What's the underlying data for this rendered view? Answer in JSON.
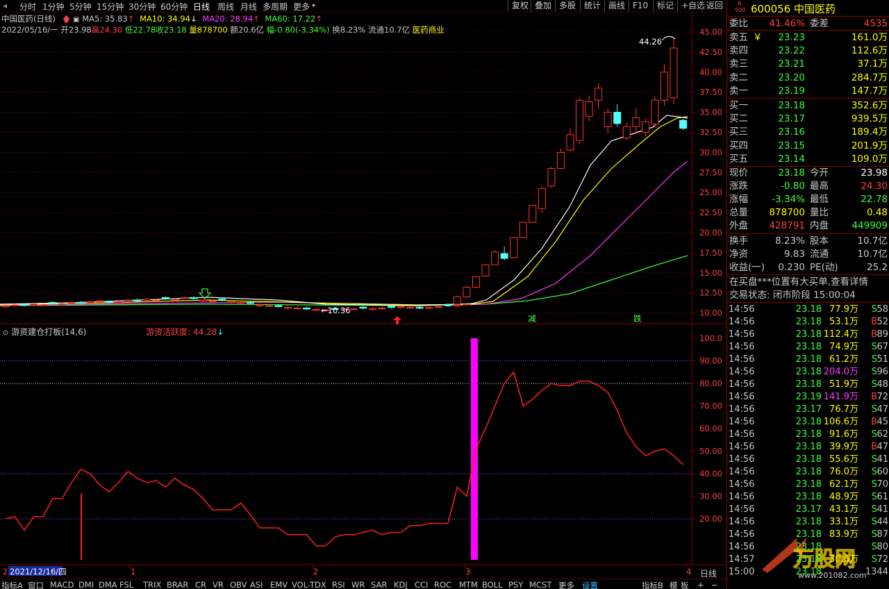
{
  "toolbar": {
    "periods": [
      "分时",
      "1分钟",
      "5分钟",
      "15分钟",
      "30分钟",
      "60分钟",
      "日线",
      "周线",
      "月线",
      "多周期",
      "更多"
    ],
    "active_period": "日线",
    "right_buttons": [
      "复权",
      "叠加",
      "多股",
      "统计",
      "画线",
      "F10",
      "标记",
      "+自选",
      "返回"
    ]
  },
  "stock": {
    "title": "中国医药(日线)",
    "ma5": "MA5: 35.83",
    "ma10": "MA10: 34.94",
    "ma20": "MA20: 28.94",
    "ma60": "MA60: 17.22",
    "date": "2022/05/16/一",
    "open": "开23.98",
    "high": "高24.30",
    "low": "低22.78",
    "close": "收23.18",
    "vol": "量878700",
    "amount": "额20.6亿",
    "change": "幅-0.80(-3.34%)",
    "turnover": "换8.23%",
    "float": "流通10.7亿",
    "sector": "医药商业"
  },
  "main_chart": {
    "y_ticks": [
      "45.00",
      "42.50",
      "40.00",
      "37.50",
      "35.00",
      "32.50",
      "30.00",
      "27.50",
      "25.00",
      "22.50",
      "20.00",
      "17.50",
      "15.00",
      "12.50",
      "10.00"
    ],
    "high_label": "44.26",
    "low_label": "10.36",
    "jian_label": "减",
    "die_label": "跌"
  },
  "indicator": {
    "name": "游资建仓打板(14,6)",
    "value": "游资活跃度: 44.28",
    "y_ticks": [
      "100.0",
      "90.00",
      "80.00",
      "70.00",
      "60.00",
      "50.00",
      "40.00",
      "30.00",
      "20.00"
    ]
  },
  "x_axis": {
    "start_date": "2021/12/16/四",
    "month_labels": [
      "1",
      "2",
      "3",
      "4"
    ],
    "period_label": "日线"
  },
  "chart_data": {
    "type": "line",
    "series": [
      {
        "name": "游资活跃度",
        "values": [
          20,
          21,
          15,
          21,
          21,
          29,
          29,
          36,
          42,
          40,
          35,
          32,
          36,
          41,
          38,
          36,
          37,
          34,
          38,
          35,
          33,
          29,
          24,
          24,
          24,
          27,
          22,
          16,
          16,
          16,
          13,
          13,
          13,
          8,
          8,
          12,
          13,
          13,
          14,
          15,
          13,
          14,
          14,
          17,
          17,
          18,
          18,
          18,
          34,
          30,
          51,
          60,
          70,
          80,
          85,
          70,
          73,
          77,
          80,
          79,
          79,
          81,
          81,
          79,
          76,
          68,
          58,
          52,
          48,
          50,
          51,
          48,
          44
        ]
      }
    ],
    "ylim": [
      0,
      100
    ]
  },
  "quote": {
    "code_prefix": "R",
    "code_sub": "500",
    "code": "600056",
    "name": "中国医药",
    "weibi_label": "委比",
    "weibi": "41.46%",
    "weicha_label": "委差",
    "weicha": "4535",
    "asks": [
      {
        "label": "卖五",
        "price": "23.23",
        "vol": "161.0万"
      },
      {
        "label": "卖四",
        "price": "23.22",
        "vol": "112.6万"
      },
      {
        "label": "卖三",
        "price": "23.21",
        "vol": "37.1万"
      },
      {
        "label": "卖二",
        "price": "23.20",
        "vol": "284.7万"
      },
      {
        "label": "卖一",
        "price": "23.19",
        "vol": "147.7万"
      }
    ],
    "ask_unit_label": "￥",
    "bids": [
      {
        "label": "买一",
        "price": "23.18",
        "vol": "352.6万"
      },
      {
        "label": "买二",
        "price": "23.17",
        "vol": "939.5万"
      },
      {
        "label": "买三",
        "price": "23.16",
        "vol": "189.4万"
      },
      {
        "label": "买四",
        "price": "23.15",
        "vol": "201.9万"
      },
      {
        "label": "买五",
        "price": "23.14",
        "vol": "109.0万"
      }
    ],
    "stats": [
      {
        "l1": "现价",
        "v1": "23.18",
        "l2": "今开",
        "v2": "23.98"
      },
      {
        "l1": "涨跌",
        "v1": "-0.80",
        "l2": "最高",
        "v2": "24.30"
      },
      {
        "l1": "涨幅",
        "v1": "-3.34%",
        "l2": "最低",
        "v2": "22.78"
      },
      {
        "l1": "总量",
        "v1": "878700",
        "l2": "量比",
        "v2": "0.48"
      },
      {
        "l1": "外盘",
        "v1": "428791",
        "l2": "内盘",
        "v2": "449909"
      }
    ],
    "stats2": [
      {
        "l1": "换手",
        "v1": "8.23%",
        "l2": "股本",
        "v2": "10.7亿"
      },
      {
        "l1": "净资",
        "v1": "9.83",
        "l2": "流通",
        "v2": "10.7亿"
      },
      {
        "l1": "收益(一)",
        "v1": "0.230",
        "l2": "PE(动)",
        "v2": "25.2"
      }
    ],
    "notice": "在买盘***位置有大买单,查看详情",
    "status": "交易状态: 闭市阶段 15:00:04"
  },
  "ticks": [
    {
      "t": "14:56",
      "p": "23.18",
      "v": "77.9万",
      "bs": "S",
      "n": "58"
    },
    {
      "t": "14:56",
      "p": "23.18",
      "v": "53.1万",
      "bs": "B",
      "n": "52"
    },
    {
      "t": "14:56",
      "p": "23.18",
      "v": "112.4万",
      "bs": "B",
      "n": "89"
    },
    {
      "t": "14:56",
      "p": "23.18",
      "v": "74.9万",
      "bs": "S",
      "n": "67"
    },
    {
      "t": "14:56",
      "p": "23.18",
      "v": "61.2万",
      "bs": "S",
      "n": "51"
    },
    {
      "t": "14:56",
      "p": "23.18",
      "v": "204.0万",
      "bs": "S",
      "n": "96"
    },
    {
      "t": "14:56",
      "p": "23.18",
      "v": "51.9万",
      "bs": "S",
      "n": "48"
    },
    {
      "t": "14:56",
      "p": "23.19",
      "v": "141.9万",
      "bs": "B",
      "n": "72"
    },
    {
      "t": "14:56",
      "p": "23.17",
      "v": "76.7万",
      "bs": "S",
      "n": "47"
    },
    {
      "t": "14:56",
      "p": "23.18",
      "v": "106.6万",
      "bs": "B",
      "n": "45"
    },
    {
      "t": "14:56",
      "p": "23.18",
      "v": "91.6万",
      "bs": "S",
      "n": "62"
    },
    {
      "t": "14:56",
      "p": "23.18",
      "v": "39.9万",
      "bs": "B",
      "n": "47"
    },
    {
      "t": "14:56",
      "p": "23.18",
      "v": "55.6万",
      "bs": "S",
      "n": "41"
    },
    {
      "t": "14:56",
      "p": "23.18",
      "v": "76.0万",
      "bs": "S",
      "n": "60"
    },
    {
      "t": "14:56",
      "p": "23.18",
      "v": "62.1万",
      "bs": "S",
      "n": "70"
    },
    {
      "t": "14:56",
      "p": "23.18",
      "v": "48.9万",
      "bs": "S",
      "n": "61"
    },
    {
      "t": "14:56",
      "p": "23.17",
      "v": "43.1万",
      "bs": "S",
      "n": "41"
    },
    {
      "t": "14:56",
      "p": "23.18",
      "v": "33.1万",
      "bs": "S",
      "n": "44"
    },
    {
      "t": "14:56",
      "p": "23.18",
      "v": "83.9万",
      "bs": "S",
      "n": "87"
    },
    {
      "t": "14:56",
      "p": "23.18",
      "v": "",
      "bs": "S",
      "n": "80"
    },
    {
      "t": "14:57",
      "p": "23.18",
      "v": "30.6万",
      "bs": "S",
      "n": "72"
    },
    {
      "t": "15:00",
      "p": "23.18",
      "v": "",
      "bs": "",
      "n": "1344"
    }
  ],
  "watermark": "www.201082.com",
  "bottom_tabs": [
    "指标A",
    "窗口",
    "MACD",
    "DMI",
    "DMA",
    "FSL",
    "TRIX",
    "BRAR",
    "CR",
    "VR",
    "OBV",
    "ASI",
    "EMV",
    "VOL-TDX",
    "RSI",
    "WR",
    "SAR",
    "KDJ",
    "CCI",
    "ROC",
    "MTM",
    "BOLL",
    "PSY",
    "MCST",
    "更多",
    "设置"
  ],
  "bottom_right": [
    "指标B",
    "模",
    "板",
    "+",
    "−"
  ],
  "colors": {
    "up": "#ff3232",
    "down": "#54ffff",
    "ma5": "#ffffff",
    "ma10": "#ffff00",
    "ma20": "#ff3cff",
    "ma60": "#3cff3c",
    "frame": "#8b0000"
  }
}
